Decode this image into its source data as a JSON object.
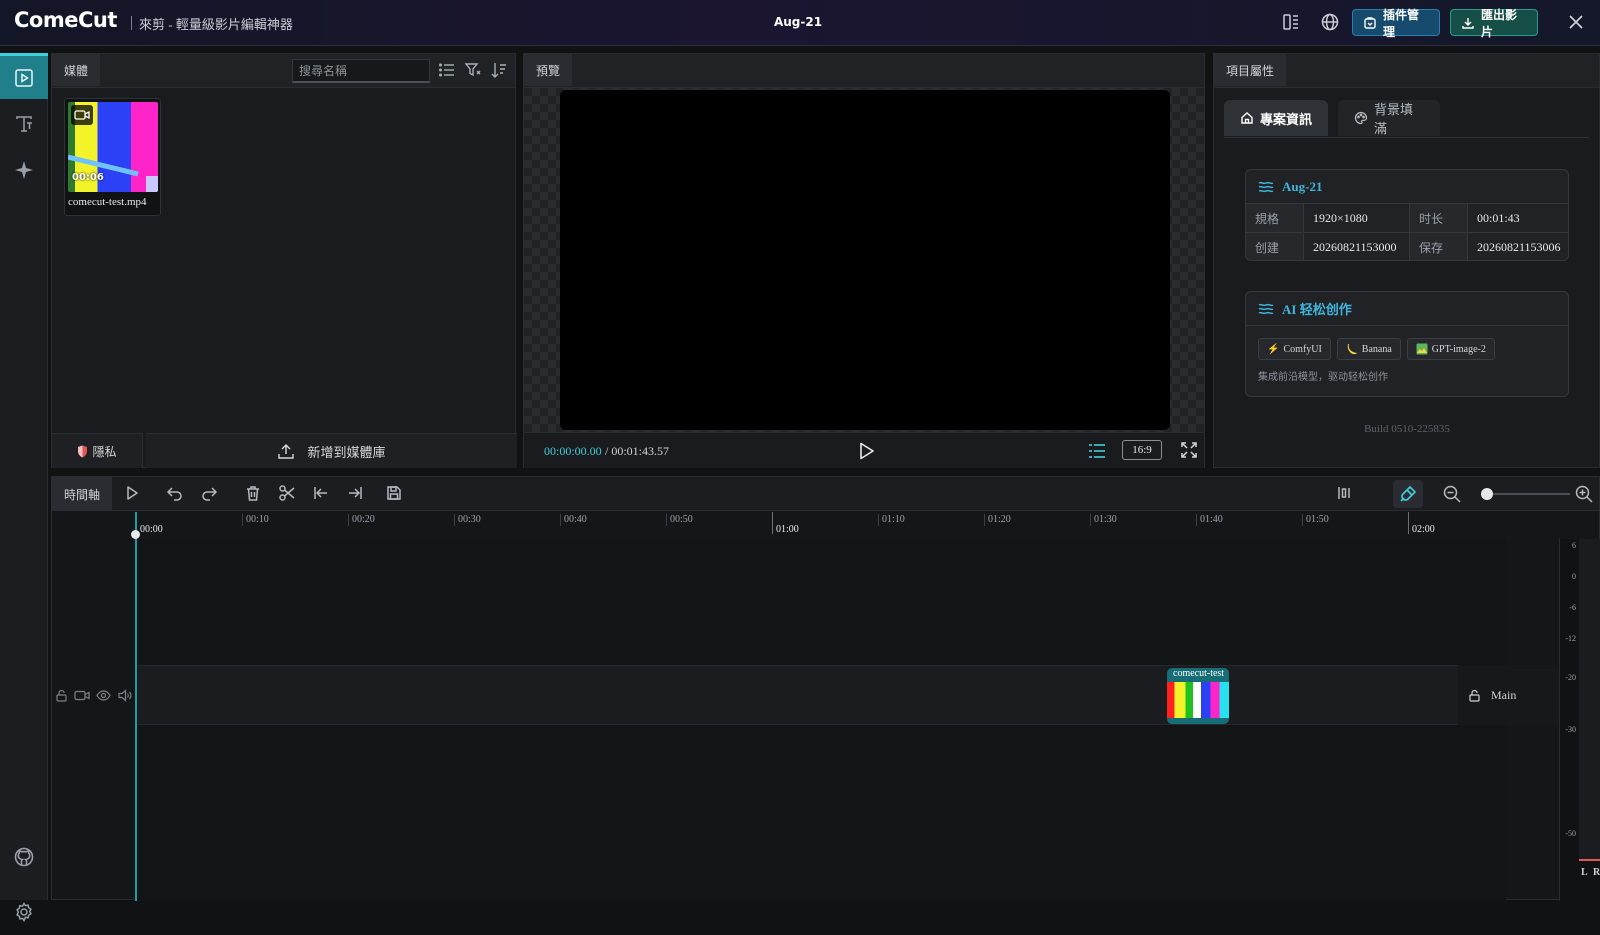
{
  "app": {
    "logo": "ComeCut",
    "subtitle": "來剪 - 輕量級影片編輯神器",
    "project_title": "Aug-21",
    "plugin_button": "插件管理",
    "export_button": "匯出影片"
  },
  "media": {
    "tab": "媒體",
    "search_placeholder": "搜尋名稱",
    "items": [
      {
        "name": "comecut-test.mp4",
        "duration": "00:06"
      }
    ],
    "privacy_button": "隱私",
    "add_button": "新增到媒體庫"
  },
  "preview": {
    "tab": "預覽",
    "time_current": "00:00:00.00",
    "time_total": "/ 00:01:43.57",
    "ratio": "16:9"
  },
  "properties": {
    "tab": "項目屬性",
    "tabs": [
      "專案資訊",
      "背景填滿"
    ],
    "info_card": {
      "title": "Aug-21",
      "rows": [
        {
          "k1": "規格",
          "v1": "1920×1080",
          "k2": "时长",
          "v2": "00:01:43"
        },
        {
          "k1": "创建",
          "v1": "20260821153000",
          "k2": "保存",
          "v2": "20260821153006"
        }
      ]
    },
    "ai_card": {
      "title": "AI 轻松创作",
      "chips": [
        "ComfyUI",
        "Banana",
        "GPT-image-2"
      ],
      "desc": "集成前沿模型，驱动轻松创作"
    },
    "build": "Build 0510-225835"
  },
  "timeline": {
    "tab": "時間軸",
    "ruler_labels": [
      "00:00",
      "00:10",
      "00:20",
      "00:30",
      "00:40",
      "00:50",
      "01:00",
      "01:10",
      "01:20",
      "01:30",
      "01:40",
      "01:50",
      "02:00"
    ],
    "clip_label": "comecut-test",
    "track_name": "Main",
    "meter_labels": [
      "6",
      "0",
      "-6",
      "-12",
      "-20",
      "-30",
      "-50"
    ],
    "meter_channels": [
      "L",
      "R"
    ]
  }
}
